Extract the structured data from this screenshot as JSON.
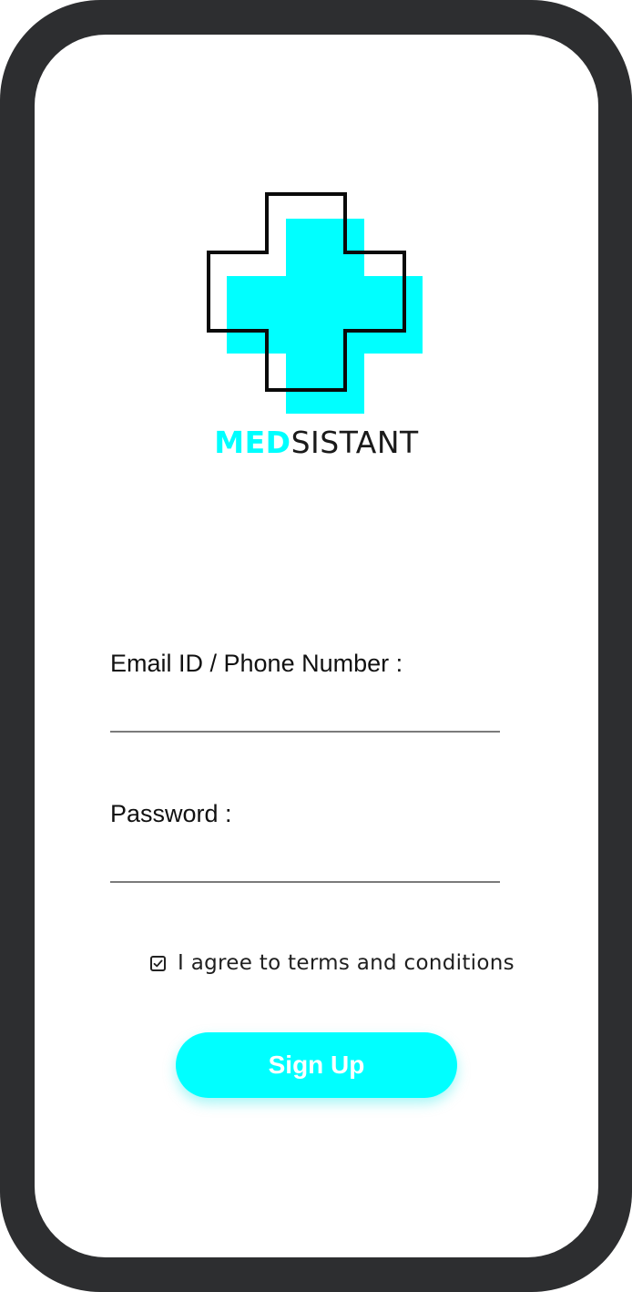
{
  "app": {
    "brand_strong": "MED",
    "brand_light": "SISTANT"
  },
  "form": {
    "email_label": "Email ID / Phone Number :",
    "email_value": "",
    "password_label": "Password :",
    "password_value": "",
    "agree_text": "I agree to terms and conditions",
    "agree_checked": true,
    "signup_label": "Sign Up"
  },
  "icons": {
    "logo": "medical-cross-icon",
    "checkbox_mark": "checkmark-icon"
  },
  "colors": {
    "accent": "#00ffff",
    "frame": "#2d2e30",
    "text": "#111111",
    "button_text": "#ffffff"
  }
}
